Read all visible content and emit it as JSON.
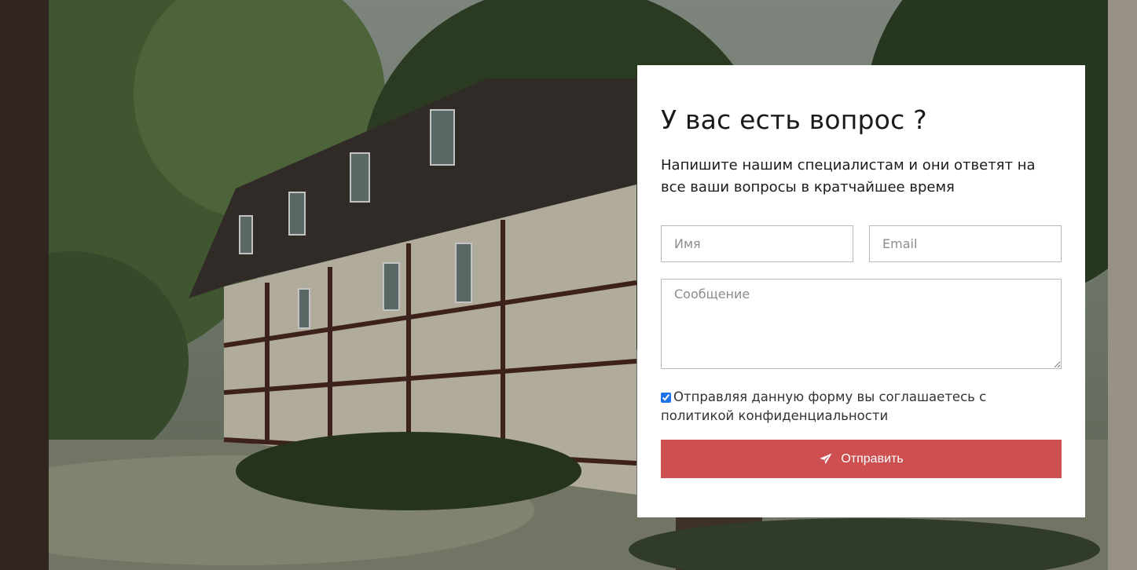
{
  "form": {
    "title": "У вас есть вопрос ?",
    "subtitle": "Напишите нашим специалистам и они ответят на все ваши вопросы в кратчайшее время",
    "name_placeholder": "Имя",
    "email_placeholder": "Email",
    "message_placeholder": "Сообщение",
    "consent_text": "Отправляя данную форму вы соглашаетесь с политикой конфиденциальности",
    "consent_checked": true,
    "submit_label": "Отправить",
    "submit_icon": "paper-plane-icon",
    "accent_color": "#cd4f4f"
  }
}
